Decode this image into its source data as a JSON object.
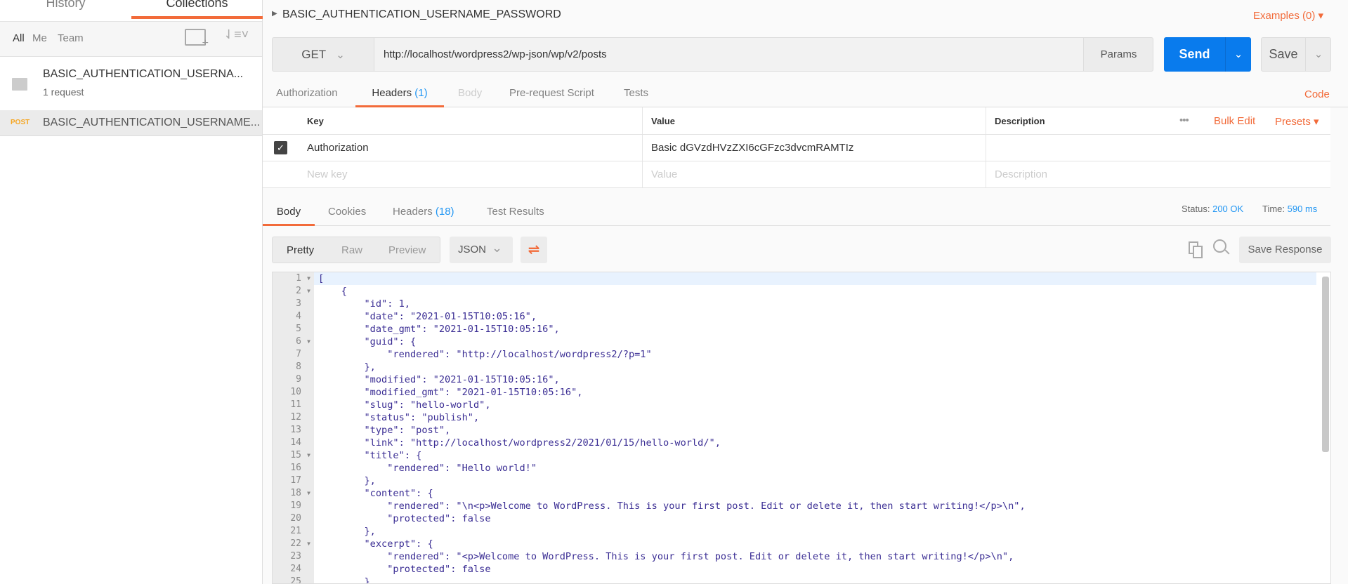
{
  "sidebar": {
    "tabs": [
      "History",
      "Collections"
    ],
    "filters": [
      "All",
      "Me",
      "Team"
    ],
    "collection": {
      "name": "BASIC_AUTHENTICATION_USERNA...",
      "count": "1 request"
    },
    "request": {
      "method": "POST",
      "name": "BASIC_AUTHENTICATION_USERNAME..."
    }
  },
  "request": {
    "title": "BASIC_AUTHENTICATION_USERNAME_PASSWORD",
    "examples": "Examples (0)",
    "method": "GET",
    "url": "http://localhost/wordpress2/wp-json/wp/v2/posts",
    "params": "Params",
    "send": "Send",
    "save": "Save",
    "tabs": [
      {
        "label": "Authorization"
      },
      {
        "label": "Headers",
        "count": "(1)"
      },
      {
        "label": "Body"
      },
      {
        "label": "Pre-request Script"
      },
      {
        "label": "Tests"
      }
    ],
    "code": "Code"
  },
  "headers": {
    "columns": [
      "Key",
      "Value",
      "Description"
    ],
    "bulk_edit": "Bulk Edit",
    "presets": "Presets",
    "rows": [
      {
        "checked": true,
        "key": "Authorization",
        "value": "Basic dGVzdHVzZXI6cGFzc3dvcmRAMTIz",
        "description": ""
      }
    ],
    "placeholders": {
      "key": "New key",
      "value": "Value",
      "description": "Description"
    }
  },
  "response": {
    "tabs": [
      {
        "label": "Body"
      },
      {
        "label": "Cookies"
      },
      {
        "label": "Headers",
        "count": "(18)"
      },
      {
        "label": "Test Results"
      }
    ],
    "status_label": "Status:",
    "status": "200 OK",
    "time_label": "Time:",
    "time": "590 ms",
    "views": [
      "Pretty",
      "Raw",
      "Preview"
    ],
    "format": "JSON",
    "save_response": "Save Response",
    "fold_lines": [
      1,
      2,
      6,
      15,
      18,
      22
    ],
    "lines": [
      "[",
      "    {",
      "        \"id\": 1,",
      "        \"date\": \"2021-01-15T10:05:16\",",
      "        \"date_gmt\": \"2021-01-15T10:05:16\",",
      "        \"guid\": {",
      "            \"rendered\": \"http://localhost/wordpress2/?p=1\"",
      "        },",
      "        \"modified\": \"2021-01-15T10:05:16\",",
      "        \"modified_gmt\": \"2021-01-15T10:05:16\",",
      "        \"slug\": \"hello-world\",",
      "        \"status\": \"publish\",",
      "        \"type\": \"post\",",
      "        \"link\": \"http://localhost/wordpress2/2021/01/15/hello-world/\",",
      "        \"title\": {",
      "            \"rendered\": \"Hello world!\"",
      "        },",
      "        \"content\": {",
      "            \"rendered\": \"\\n<p>Welcome to WordPress. This is your first post. Edit or delete it, then start writing!</p>\\n\",",
      "            \"protected\": false",
      "        },",
      "        \"excerpt\": {",
      "            \"rendered\": \"<p>Welcome to WordPress. This is your first post. Edit or delete it, then start writing!</p>\\n\",",
      "            \"protected\": false",
      "        },"
    ]
  },
  "colors": {
    "accent": "#f26b3a",
    "primary": "#097bed",
    "link": "#2196f3"
  }
}
